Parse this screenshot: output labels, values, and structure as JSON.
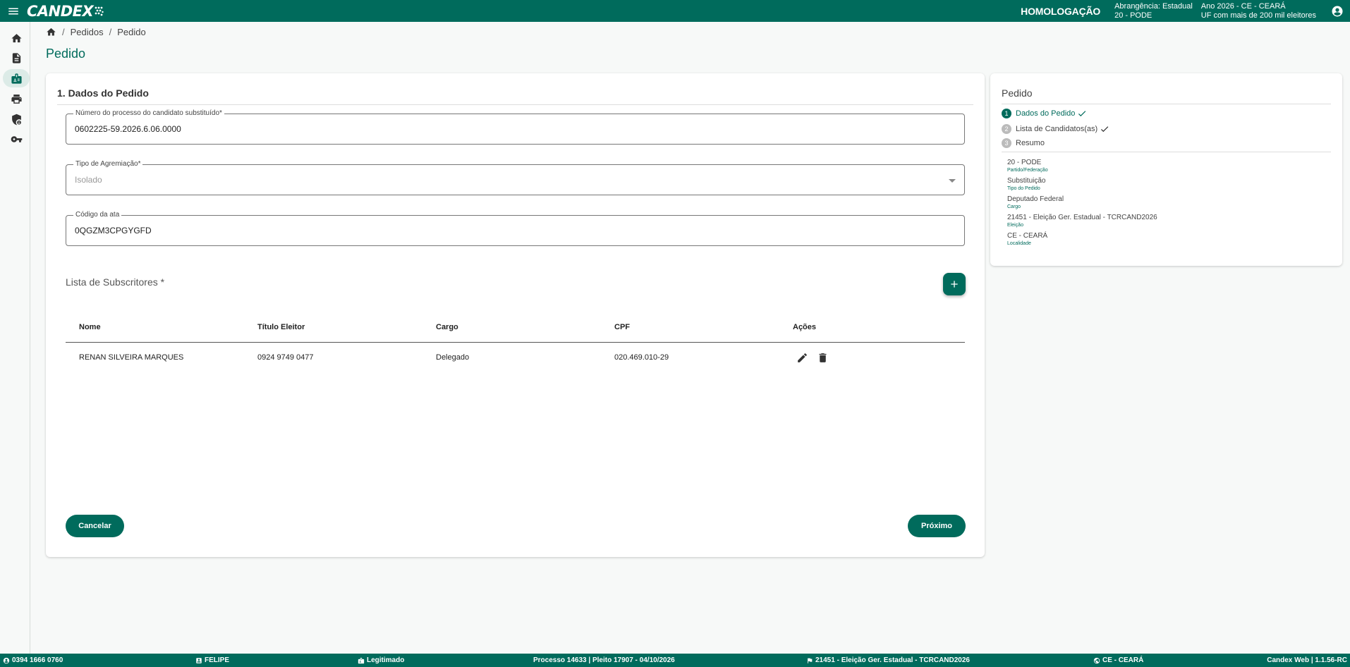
{
  "app": {
    "logo": "CANDEX",
    "environment": "HOMOLOGAÇÃO",
    "abrangencia": "Abrangência: Estadual",
    "partido": "20 - PODE",
    "ano": "Ano 2026 - CE - CEARÁ",
    "uf_info": "UF com mais de 200 mil eleitores"
  },
  "sidebar": {
    "items": [
      {
        "name": "home",
        "icon": "home-icon"
      },
      {
        "name": "documents",
        "icon": "document-icon"
      },
      {
        "name": "candidates",
        "icon": "badge-icon"
      },
      {
        "name": "print",
        "icon": "printer-icon"
      },
      {
        "name": "security",
        "icon": "shield-icon"
      },
      {
        "name": "keys",
        "icon": "key-icon"
      }
    ],
    "active_index": 2
  },
  "breadcrumb": {
    "items": [
      "Pedidos",
      "Pedido"
    ]
  },
  "page": {
    "title": "Pedido"
  },
  "form": {
    "section_title": "1. Dados do Pedido",
    "fields": {
      "processo": {
        "label": "Número do processo do candidato substituído*",
        "value": "0602225-59.2026.6.06.0000"
      },
      "agremiacao": {
        "label": "Tipo de Agremiação*",
        "value": "Isolado"
      },
      "ata": {
        "label": "Código da ata",
        "value": "0QGZM3CPGYGFD"
      }
    },
    "subscritores": {
      "title": "Lista de Subscritores *",
      "columns": [
        "Nome",
        "Título Eleitor",
        "Cargo",
        "CPF",
        "Ações"
      ],
      "rows": [
        {
          "nome": "RENAN SILVEIRA MARQUES",
          "titulo": "0924 9749 0477",
          "cargo": "Delegado",
          "cpf": "020.469.010-29"
        }
      ]
    },
    "buttons": {
      "cancel": "Cancelar",
      "next": "Próximo"
    }
  },
  "panel": {
    "title": "Pedido",
    "steps": [
      {
        "num": "1",
        "label": "Dados do Pedido",
        "done": true
      },
      {
        "num": "2",
        "label": "Lista de Candidatos(as)",
        "done": true
      },
      {
        "num": "3",
        "label": "Resumo",
        "done": false
      }
    ],
    "summary": [
      {
        "value": "20 - PODE",
        "label": "Partido/Federação"
      },
      {
        "value": "Substituição",
        "label": "Tipo do Pedido"
      },
      {
        "value": "Deputado Federal",
        "label": "Cargo"
      },
      {
        "value": "21451 - Eleição Ger. Estadual - TCRCAND2026",
        "label": "Eleição"
      },
      {
        "value": "CE - CEARÁ",
        "label": "Localidade"
      }
    ]
  },
  "footer": {
    "user_id": "0394 1666 0760",
    "user_name": "FELIPE",
    "role": "Legitimado",
    "processo": "Processo 14633 | Pleito 17907 - 04/10/2026",
    "eleicao": "21451 - Eleição Ger. Estadual - TCRCAND2026",
    "localidade": "CE - CEARÁ",
    "version": "Candex Web | 1.1.56-RC"
  },
  "colors": {
    "primary": "#006b5c",
    "background": "#f7f9f8"
  }
}
